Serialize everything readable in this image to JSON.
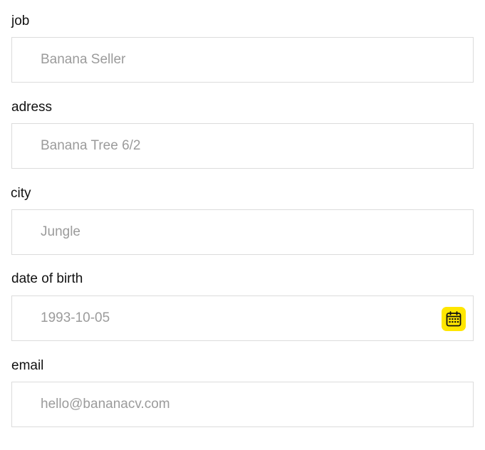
{
  "form": {
    "fields": [
      {
        "label": "job",
        "placeholder": "Banana Seller"
      },
      {
        "label": "adress",
        "placeholder": "Banana Tree 6/2"
      },
      {
        "label": "city",
        "placeholder": "Jungle"
      },
      {
        "label": "date of birth",
        "placeholder": "1993-10-05"
      },
      {
        "label": "email",
        "placeholder": "hello@bananacv.com"
      }
    ]
  },
  "icons": {
    "calendar": "calendar-icon"
  },
  "colors": {
    "accent": "#ffe600",
    "border": "#dcdcdc",
    "placeholder": "#9b9b9b",
    "label": "#111111"
  }
}
